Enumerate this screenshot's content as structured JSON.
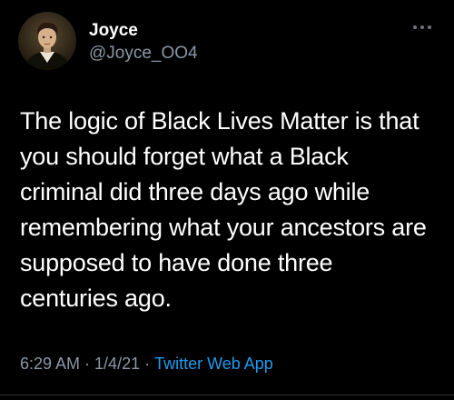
{
  "tweet": {
    "display_name": "Joyce",
    "handle": "@Joyce_OO4",
    "text": "The logic of Black Lives Matter is that\nyou should forget what a Black\ncriminal did three days ago while\nremembering what your ancestors are\nsupposed to have done three\ncenturies ago.",
    "time": "6:29 AM",
    "separator": "·",
    "date": "1/4/21",
    "source": "Twitter Web App"
  },
  "icons": {
    "more": "more-horizontal-icon",
    "avatar": "portrait-avatar"
  },
  "colors": {
    "background": "#000000",
    "text": "#ffffff",
    "muted": "#8b98a5",
    "link": "#1d9bf0"
  }
}
